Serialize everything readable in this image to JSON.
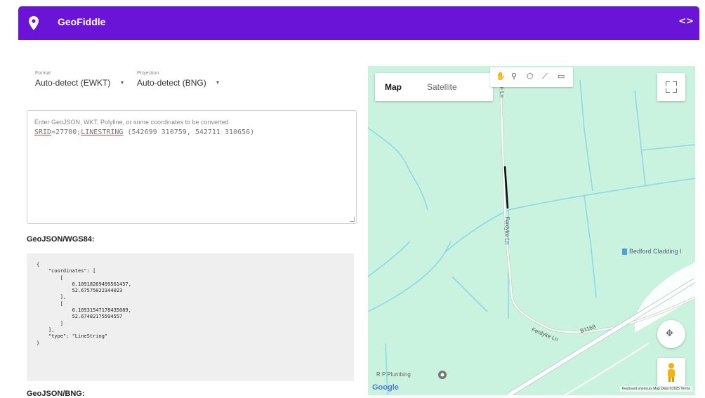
{
  "app": {
    "title": "GeoFiddle",
    "code_glyph": "<>",
    "logo_icon": "map-pin-icon",
    "color": "#6a14d8"
  },
  "format": {
    "label": "Format",
    "value": "Auto-detect (EWKT)"
  },
  "projection": {
    "label": "Projection",
    "value": "Auto-detect (BNG)"
  },
  "input": {
    "placeholder": "Enter GeoJSON, WKT, Polyline, or some coordinates to be converted",
    "value_srid": "SRID",
    "value_mid": "=27700;",
    "value_type": "LINESTRING",
    "value_rest": " (542699 310759, 542711 310656)"
  },
  "output": {
    "heading": "GeoJSON/WGS84:",
    "json": "{\n    \"coordinates\": [\n        [\n            0.10918269499561457,\n            52.67575022344023\n        ],\n        [\n            0.10931547178435089,\n            52.67482175594557\n        ]\n    ],\n    \"type\": \"LineString\"\n}",
    "next_heading": "GeoJSON/BNG:"
  },
  "map": {
    "tabs": {
      "map": "Map",
      "satellite": "Satellite"
    },
    "active_tab": "Map",
    "draw_tools": [
      "hand-icon",
      "marker-icon",
      "polygon-icon",
      "polyline-icon",
      "rectangle-icon"
    ],
    "labels": {
      "road_north": "Fen Ln",
      "road_mid": "Ferdyke Ln",
      "road_south": "Ferdyke Ln",
      "b_road": "B1169",
      "poi_bedford": "Bedford Cladding I",
      "poi_plumbing": "R P Plumbing"
    },
    "google": "Google",
    "attribution": "Keyboard shortcuts   Map Data ©2025   Terms",
    "colors": {
      "land": "#c9f3de",
      "water": "#8fd8e8",
      "road": "#ffffff"
    }
  }
}
